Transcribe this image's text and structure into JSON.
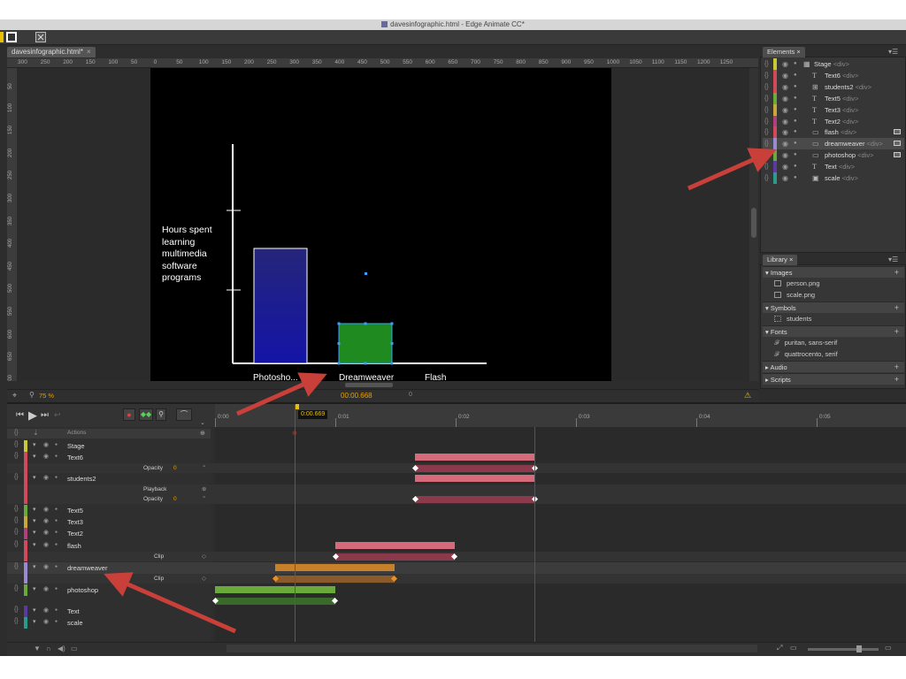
{
  "window_title": "davesinfographic.html - Edge Animate CC*",
  "doc_tab": {
    "label": "davesinfographic.html*",
    "close": "×"
  },
  "rulers": {
    "h_ticks": [
      "300",
      "250",
      "200",
      "150",
      "100",
      "50",
      "0",
      "50",
      "100",
      "150",
      "200",
      "250",
      "300",
      "350",
      "400",
      "450",
      "500",
      "550",
      "600",
      "650",
      "700",
      "750",
      "800",
      "850",
      "900",
      "950",
      "1000",
      "1050",
      "1100",
      "1150",
      "1200",
      "1250"
    ],
    "v_ticks": [
      "50",
      "100",
      "150",
      "200",
      "250",
      "300",
      "350",
      "400",
      "450",
      "500",
      "550",
      "600",
      "650",
      "700"
    ]
  },
  "stage": {
    "chart_caption_lines": [
      "Hours spent",
      "learning",
      "multimedia",
      "software",
      "programs"
    ],
    "bar_labels": [
      "Photosho...",
      "Dreamweaver",
      "Flash"
    ]
  },
  "chart_data": {
    "type": "bar",
    "categories": [
      "Photosho...",
      "Dreamweaver",
      "Flash"
    ],
    "values": [
      130,
      45,
      0
    ],
    "title": "Hours spent learning multimedia software programs",
    "colors": [
      "#1a1a9a",
      "#1f8a1f",
      "#000000"
    ]
  },
  "stage_footer": {
    "zoom": "75 %",
    "time": "00:00.668",
    "frame": "0"
  },
  "elements_panel": {
    "tab": "Elements",
    "close": "×",
    "items": [
      {
        "name": "Stage",
        "tag": "<div>",
        "color": "#c8c83a",
        "type": "stage"
      },
      {
        "name": "Text6",
        "tag": "<div>",
        "color": "#d14a5a",
        "type": "T"
      },
      {
        "name": "students2",
        "tag": "<div>",
        "color": "#d14a5a",
        "type": "sym"
      },
      {
        "name": "Text5",
        "tag": "<div>",
        "color": "#6aaa3a",
        "type": "T"
      },
      {
        "name": "Text3",
        "tag": "<div>",
        "color": "#c8a83a",
        "type": "T"
      },
      {
        "name": "Text2",
        "tag": "<div>",
        "color": "#b0407a",
        "type": "T"
      },
      {
        "name": "flash",
        "tag": "<div>",
        "color": "#d14a5a",
        "type": "rect"
      },
      {
        "name": "dreamweaver",
        "tag": "<div>",
        "color": "#9a8ad0",
        "type": "rect"
      },
      {
        "name": "photoshop",
        "tag": "<div>",
        "color": "#6aaa3a",
        "type": "rect"
      },
      {
        "name": "Text",
        "tag": "<div>",
        "color": "#5a3aa0",
        "type": "T"
      },
      {
        "name": "scale",
        "tag": "<div>",
        "color": "#2a9a8a",
        "type": "img"
      }
    ]
  },
  "library_panel": {
    "tab": "Library",
    "close": "×",
    "sections": [
      {
        "label": "Images",
        "items": [
          "person.png",
          "scale.png"
        ]
      },
      {
        "label": "Symbols",
        "items": [
          "students"
        ]
      },
      {
        "label": "Fonts",
        "items": [
          "puritan, sans-serif",
          "quattrocento, serif"
        ]
      },
      {
        "label": "Audio",
        "items": []
      },
      {
        "label": "Scripts",
        "items": []
      }
    ]
  },
  "timeline": {
    "playhead": "0:00.669",
    "time_marks": [
      "0:00",
      "0:01",
      "0:02",
      "0:03",
      "0:04",
      "0:05"
    ],
    "actions_label": "Actions",
    "rows": [
      {
        "name": "Stage",
        "color": "#c8c83a"
      },
      {
        "name": "Text6",
        "color": "#d14a5a"
      },
      {
        "sub": "Opacity",
        "value": "0"
      },
      {
        "name": "students2",
        "color": "#d14a5a"
      },
      {
        "sub": "Playback"
      },
      {
        "sub": "Opacity",
        "value": "0"
      },
      {
        "name": "Text5",
        "color": "#6aaa3a"
      },
      {
        "name": "Text3",
        "color": "#c8a83a"
      },
      {
        "name": "Text2",
        "color": "#b0407a"
      },
      {
        "name": "flash",
        "color": "#d14a5a"
      },
      {
        "sub": "Clip"
      },
      {
        "name": "dreamweaver",
        "color": "#9a8ad0"
      },
      {
        "sub": "Clip"
      },
      {
        "name": "photoshop",
        "color": "#6aaa3a"
      },
      {
        "name": "Text",
        "color": "#5a3aa0"
      },
      {
        "name": "scale",
        "color": "#2a9a8a"
      }
    ]
  }
}
